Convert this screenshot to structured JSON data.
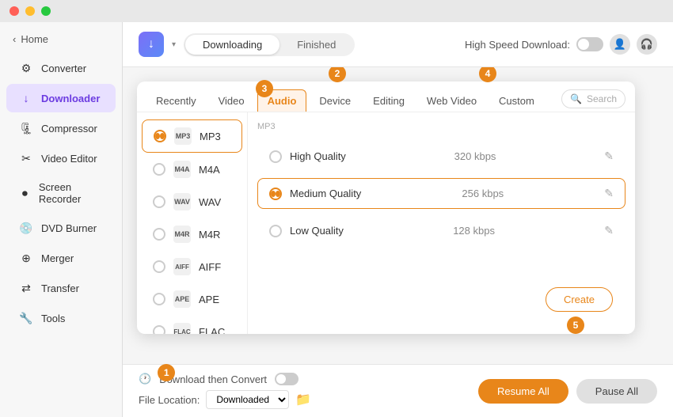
{
  "titleBar": {
    "trafficLights": [
      "close",
      "minimize",
      "maximize"
    ]
  },
  "topBar": {
    "appIconSymbol": "↓",
    "tabs": [
      {
        "label": "Downloading",
        "active": true
      },
      {
        "label": "Finished",
        "active": false
      }
    ],
    "highSpeedDownload": "High Speed Download:",
    "userIconSymbol": "👤",
    "supportIconSymbol": "🎧"
  },
  "sidebar": {
    "homeLabel": "Home",
    "items": [
      {
        "id": "converter",
        "label": "Converter",
        "icon": "⚙"
      },
      {
        "id": "downloader",
        "label": "Downloader",
        "icon": "↓",
        "active": true
      },
      {
        "id": "compressor",
        "label": "Compressor",
        "icon": "🗜"
      },
      {
        "id": "video-editor",
        "label": "Video Editor",
        "icon": "✂"
      },
      {
        "id": "screen-recorder",
        "label": "Screen Recorder",
        "icon": "⏺"
      },
      {
        "id": "dvd-burner",
        "label": "DVD Burner",
        "icon": "💿"
      },
      {
        "id": "merger",
        "label": "Merger",
        "icon": "⊕"
      },
      {
        "id": "transfer",
        "label": "Transfer",
        "icon": "⇄"
      },
      {
        "id": "tools",
        "label": "Tools",
        "icon": "🔧"
      }
    ]
  },
  "dropdown": {
    "formatTabs": [
      {
        "label": "Recently",
        "active": false
      },
      {
        "label": "Video",
        "active": false
      },
      {
        "label": "Audio",
        "active": true
      },
      {
        "label": "Device",
        "active": false
      },
      {
        "label": "Editing",
        "active": false
      },
      {
        "label": "Web Video",
        "active": false
      },
      {
        "label": "Custom",
        "active": false
      }
    ],
    "searchPlaceholder": "Search",
    "formatList": [
      {
        "id": "mp3",
        "label": "MP3",
        "iconText": "MP3",
        "selected": true
      },
      {
        "id": "m4a",
        "label": "M4A",
        "iconText": "M4A",
        "selected": false
      },
      {
        "id": "wav",
        "label": "WAV",
        "iconText": "WAV",
        "selected": false
      },
      {
        "id": "m4r",
        "label": "M4R",
        "iconText": "M4R",
        "selected": false
      },
      {
        "id": "aiff",
        "label": "AIFF",
        "iconText": "AIF",
        "selected": false
      },
      {
        "id": "ape",
        "label": "APE",
        "iconText": "APE",
        "selected": false
      },
      {
        "id": "flac",
        "label": "FLAC",
        "iconText": "FLA",
        "selected": false
      }
    ],
    "selectedFormatLabel": "MP3",
    "qualityList": [
      {
        "id": "high",
        "label": "High Quality",
        "kbps": "320 kbps",
        "selected": false
      },
      {
        "id": "medium",
        "label": "Medium Quality",
        "kbps": "256 kbps",
        "selected": true
      },
      {
        "id": "low",
        "label": "Low Quality",
        "kbps": "128 kbps",
        "selected": false
      }
    ],
    "createButtonLabel": "Create"
  },
  "bottomBar": {
    "downloadConvertLabel": "Download then Convert",
    "fileLocationLabel": "File Location:",
    "fileLocationValue": "Downloaded",
    "resumeAllLabel": "Resume All",
    "pauseAllLabel": "Pause All"
  },
  "badges": {
    "b1": "1",
    "b2": "2",
    "b3": "3",
    "b4": "4",
    "b5": "5"
  }
}
